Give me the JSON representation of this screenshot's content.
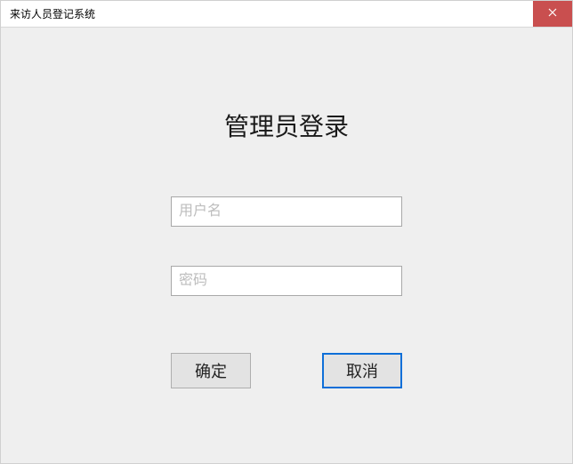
{
  "window": {
    "title": "来访人员登记系统"
  },
  "login": {
    "heading": "管理员登录",
    "username_placeholder": "用户名",
    "username_value": "",
    "password_placeholder": "密码",
    "password_value": "",
    "ok_label": "确定",
    "cancel_label": "取消"
  }
}
